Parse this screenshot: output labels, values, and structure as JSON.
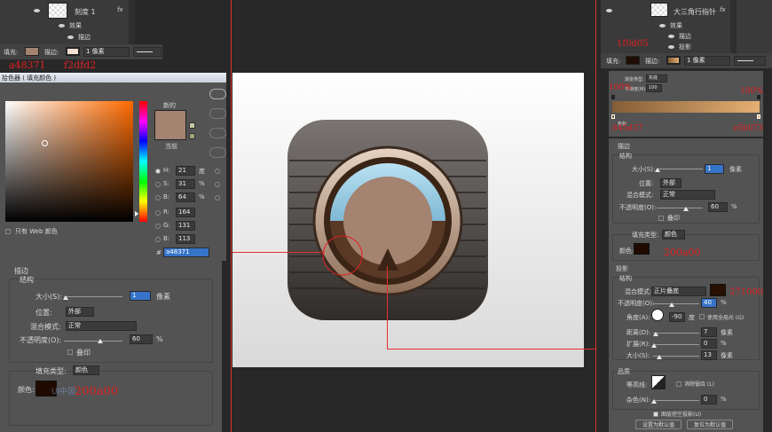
{
  "left_layer": {
    "name": "刻度 1",
    "fx": "fx",
    "effects": "效果",
    "effect_item": "描边"
  },
  "left_toolbar": {
    "fill_label": "填充:",
    "stroke_label": "描边:",
    "stroke_size": "1 像素"
  },
  "annot_left": {
    "color1": "a48371",
    "color2": "f2dfd2"
  },
  "picker": {
    "title": "拾色器 ( 填充颜色 )",
    "new_label": "新的",
    "current_label": "当前",
    "web_label": "只有 Web 颜色",
    "fields": [
      {
        "k": "H:",
        "v": "21",
        "u": "度"
      },
      {
        "k": "S:",
        "v": "31",
        "u": "%"
      },
      {
        "k": "B:",
        "v": "64",
        "u": "%"
      },
      {
        "k": "R:",
        "v": "164",
        "u": ""
      },
      {
        "k": "G:",
        "v": "131",
        "u": ""
      },
      {
        "k": "B:",
        "v": "113",
        "u": ""
      }
    ],
    "hex_label": "#",
    "hex": "a48371"
  },
  "left_stroke": {
    "title": "描边",
    "structure": "结构",
    "size_label": "大小(S):",
    "size": "1",
    "size_unit": "像素",
    "pos_label": "位置:",
    "pos": "外部",
    "blend_label": "混合模式:",
    "blend": "正常",
    "opacity_label": "不透明度(O):",
    "opacity": "60",
    "pct": "%",
    "overprint": "叠印",
    "filltype_label": "填充类型:",
    "filltype": "颜色",
    "color_label": "颜色:",
    "annot": "200a00"
  },
  "watermark": "UI中国",
  "right_layer": {
    "name": "大三角行指针",
    "fx": "fx",
    "effects": "效果",
    "item1": "描边",
    "item2": "投影"
  },
  "right_toolbar": {
    "fill_label": "填充:",
    "stroke_label": "描边:",
    "stroke_size": "1 像素"
  },
  "annot_right": {
    "top": "1f0d05",
    "p_left": "100%",
    "p_right": "100%",
    "c_left": "845d37",
    "c_right": "e5b073"
  },
  "gradient_editor": {
    "type_label": "渐变类型:",
    "type": "实底",
    "smooth_label": "平滑度(M):",
    "smooth": "100",
    "stops_label": "色标"
  },
  "right_stroke": {
    "title": "描边",
    "structure": "结构",
    "size_label": "大小(S):",
    "size": "1",
    "size_unit": "像素",
    "pos_label": "位置:",
    "pos": "外部",
    "blend_label": "混合模式:",
    "blend": "正常",
    "opacity_label": "不透明度(O):",
    "opacity": "60",
    "pct": "%",
    "overprint": "叠印",
    "filltype_label": "填充类型:",
    "filltype": "颜色",
    "color_label": "颜色:",
    "annot": "200a00"
  },
  "shadow": {
    "title": "投影",
    "structure": "结构",
    "blend_label": "混合模式:",
    "blend": "正片叠底",
    "annot": "271000",
    "opacity_label": "不透明度(O):",
    "opacity": "40",
    "pct": "%",
    "angle_label": "角度(A):",
    "angle": "-90",
    "deg": "度",
    "global": "使用全局光 (G)",
    "dist_label": "距离(D):",
    "dist": "7",
    "spread_label": "扩展(R):",
    "spread": "0",
    "size_label": "大小(S):",
    "size": "13",
    "px": "像素",
    "quality": "品质",
    "contour_label": "等高线:",
    "antialias": "消除锯齿 (L)",
    "noise_label": "杂色(N):",
    "noise": "0",
    "knockout": "图层挖空投影(U)",
    "btn_default": "设置为默认值",
    "btn_reset": "复位为默认值"
  },
  "colors": {
    "picked": "#a48371",
    "accent_red": "#e02020",
    "dark_brown": "#271000"
  }
}
